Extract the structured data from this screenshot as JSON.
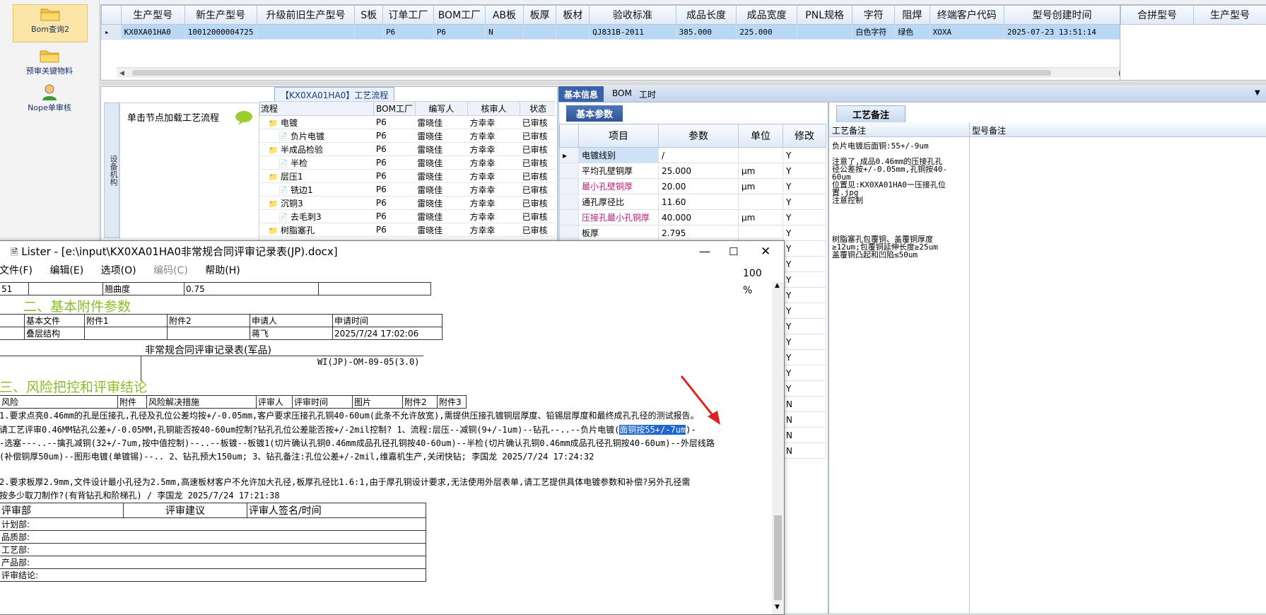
{
  "nav": {
    "items": [
      {
        "label": "Bom查询2",
        "selected": true
      },
      {
        "label": "预审关键物料",
        "selected": false
      },
      {
        "label": "Nope单审核",
        "selected": false
      }
    ]
  },
  "top_grid": {
    "columns": [
      "生产型号",
      "新生产型号",
      "升级前旧生产型号",
      "S板",
      "订单工厂",
      "BOM工厂",
      "AB板",
      "板厚",
      "板材",
      "验收标准",
      "成品长度",
      "成品宽度",
      "PNL规格",
      "字符",
      "阻焊",
      "终端客户代码",
      "型号创建时间"
    ],
    "row": [
      "KX0XA01HA0",
      "10012000004725",
      "",
      "",
      "P6",
      "P6",
      "N",
      "",
      "",
      "QJ831B-2011",
      "385.000",
      "225.000",
      "",
      "白色字符",
      "绿色",
      "XOXA",
      "2025-07-23 13:51:14"
    ],
    "side_columns": [
      "合拼型号",
      "生产型号"
    ]
  },
  "process_panel": {
    "tab_title": "【KX0XA01HA0】工艺流程",
    "side_tab": "设备机构",
    "hint": "单击节点加载工艺流程",
    "tree_columns": [
      "流程",
      "BOM工厂",
      "编写人",
      "核审人",
      "状态"
    ],
    "tree_rows": [
      {
        "name": "电镀",
        "level": 0,
        "factory": "P6",
        "writer": "雷晓佳",
        "reviewer": "方幸幸",
        "status": "已审核"
      },
      {
        "name": "负片电镀",
        "level": 1,
        "factory": "P6",
        "writer": "雷晓佳",
        "reviewer": "方幸幸",
        "status": "已审核"
      },
      {
        "name": "半成品检验",
        "level": 0,
        "factory": "P6",
        "writer": "雷晓佳",
        "reviewer": "方幸幸",
        "status": "已审核"
      },
      {
        "name": "半检",
        "level": 1,
        "factory": "P6",
        "writer": "雷晓佳",
        "reviewer": "方幸幸",
        "status": "已审核"
      },
      {
        "name": "层压1",
        "level": 0,
        "factory": "P6",
        "writer": "雷晓佳",
        "reviewer": "方幸幸",
        "status": "已审核"
      },
      {
        "name": "铣边1",
        "level": 1,
        "factory": "P6",
        "writer": "雷晓佳",
        "reviewer": "方幸幸",
        "status": "已审核"
      },
      {
        "name": "沉铜3",
        "level": 0,
        "factory": "P6",
        "writer": "雷晓佳",
        "reviewer": "方幸幸",
        "status": "已审核"
      },
      {
        "name": "去毛刺3",
        "level": 1,
        "factory": "P6",
        "writer": "雷晓佳",
        "reviewer": "方幸幸",
        "status": "已审核"
      },
      {
        "name": "树脂塞孔",
        "level": 0,
        "factory": "P6",
        "writer": "雷晓佳",
        "reviewer": "方幸幸",
        "status": "已审核"
      }
    ]
  },
  "info_panel": {
    "tabs": [
      "基本信息",
      "BOM",
      "工时"
    ],
    "subtab": "基本参数",
    "param_columns": [
      "项目",
      "参数",
      "单位",
      "修改"
    ],
    "params": [
      {
        "name": "电镀线别",
        "value": "/",
        "unit": "",
        "mod": "Y",
        "color": "#000"
      },
      {
        "name": "平均孔壁铜厚",
        "value": "25.000",
        "unit": "μm",
        "mod": "Y",
        "color": "#000"
      },
      {
        "name": "最小孔壁铜厚",
        "value": "20.00",
        "unit": "μm",
        "mod": "Y",
        "color": "#b0237a"
      },
      {
        "name": "通孔厚径比",
        "value": "11.60",
        "unit": "",
        "mod": "Y",
        "color": "#000"
      },
      {
        "name": "压接孔最小孔铜厚",
        "value": "40.000",
        "unit": "μm",
        "mod": "Y",
        "color": "#b0237a"
      },
      {
        "name": "板厚",
        "value": "2.795",
        "unit": "",
        "mod": "Y",
        "color": "#000"
      }
    ],
    "extra_mods": [
      "Y",
      "Y",
      "Y",
      "Y",
      "Y",
      "Y",
      "Y",
      "Y",
      "Y",
      "Y",
      "N",
      "N",
      "N",
      "N"
    ]
  },
  "notes_panel": {
    "tab": "工艺备注",
    "columns": [
      "工艺备注",
      "型号备注"
    ],
    "lines": [
      "负片电镀后面铜:55+/-9um",
      "",
      "注意了,成品0.46mm的压接孔孔",
      "径公差按+/-0.05mm,孔铜按40-",
      "60um",
      "位置见:KX0XA01HA0一压接孔位",
      "置.jpg",
      "注意控制",
      "",
      "",
      "",
      "",
      "树脂塞孔包覆铜、盖覆铜厚度",
      "≥12um;包覆铜延伸长度≥25um",
      "盖覆铜凸起和凹陷≤50um"
    ]
  },
  "lister": {
    "title": "Lister - [e:\\input\\KX0XA01HA0非常规合同评审记录表(JP).docx]",
    "menu": [
      "文件(F)",
      "编辑(E)",
      "选项(O)",
      "编码(C)",
      "帮助(H)"
    ],
    "zoom": "100 %",
    "row0": [
      "51",
      "",
      "翘曲度",
      "0.75",
      ""
    ],
    "section2": "二、基本附件参数",
    "attach_header": [
      "基本文件",
      "附件1",
      "附件2",
      "申请人",
      "申请时间"
    ],
    "attach_row": [
      "叠层结构",
      "",
      "",
      "蒋飞",
      "2025/7/24 17:02:06"
    ],
    "form_title": "非常规合同评审记录表(军品)",
    "form_code": "WI(JP)-OM-09-05(3.0)",
    "section3": "三、风险把控和评审结论",
    "risk_header": [
      "风险",
      "附件",
      "风险解决措施",
      "评审人",
      "评审时间",
      "图片",
      "附件2",
      "附件3"
    ],
    "risk1_a": "1.要求点亮0.46mm的孔是压接孔,孔径及孔位公差均按+/-0.05mm,客户要求压接孔孔铜40-60um(此条不允许放宽),需提供压接孔镀铜层厚度、铅锡层厚度和最终成孔孔径的测试报告。",
    "risk1_b_pre": "请工艺评审0.46MM钻孔公差+/-0.05MM,孔铜能否按40-60um控制?钻孔孔位公差能否按+/-2mil控制?     1、流程:层压--减铜(9+/-1um)--钻孔--..--负片电镀(",
    "risk1_b_hl": "面铜按55+/-7um",
    "risk1_b_post": ")-",
    "risk1_c": "-选塞---..--擒孔减铜(32+/-7um,按中值控制)--..--板镀--板镀1(切片确认孔铜0.46mm成品孔径孔铜按40-60um)--半检(切片确认孔铜0.46mm成品孔径孔铜按40-60um)--外层线路",
    "risk1_d": "(补偿铜厚50um)--图形电镀(单镀锡)--.. 2、钻孔预大150um; 3、钻孔备注:孔位公差+/-2mil,维嘉机生产,关闭快钻;     李国龙  2025/7/24 17:24:32",
    "risk2_a": "2.要求板厚2.9mm,文件设计最小孔径为2.5mm,高速板材客户不允许加大孔径,板厚孔径比1.6:1,由于厚孔铜设计要求,无法使用外层表单,请工艺提供具体电镀参数和补偿?另外孔径需",
    "risk2_b": "按多少取刀制作?(有背钻孔和阶梯孔)                      /              李国龙  2025/7/24 17:21:38",
    "review_header": [
      "评审部",
      "评审建议",
      "评审人签名/时间"
    ],
    "review_rows": [
      "计划部:",
      "品质部:",
      "工艺部:",
      "产品部:",
      "评审结论:"
    ]
  },
  "colors": {
    "arrow": "#e02020",
    "highlight": "#1e66d0"
  }
}
